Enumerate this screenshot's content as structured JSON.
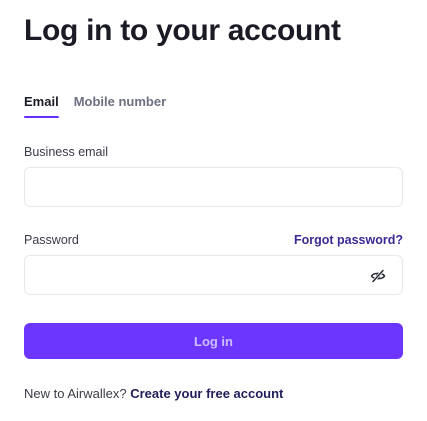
{
  "heading": "Log in to your account",
  "tabs": [
    {
      "label": "Email",
      "active": true
    },
    {
      "label": "Mobile number",
      "active": false
    }
  ],
  "email": {
    "label": "Business email",
    "value": "",
    "placeholder": ""
  },
  "password": {
    "label": "Password",
    "value": "",
    "placeholder": "",
    "forgot_label": "Forgot password?",
    "toggle_icon": "eye-off-icon"
  },
  "login_button": "Log in",
  "signup": {
    "prompt": "New to Airwallex? ",
    "link": "Create your free account"
  },
  "colors": {
    "accent": "#612fff",
    "button_bg": "#6d36ff",
    "link": "#3b2a94"
  }
}
